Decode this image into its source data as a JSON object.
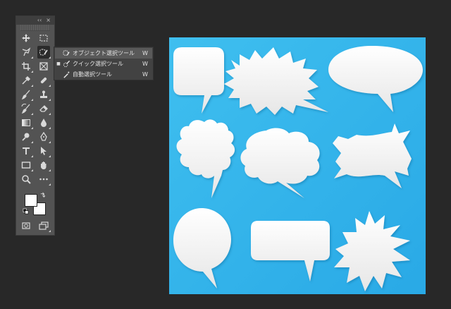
{
  "toolbar": {
    "collapse_label": "‹‹",
    "close_label": "×",
    "tools": [
      {
        "name": "move-tool-icon"
      },
      {
        "name": "marquee-tool-icon"
      },
      {
        "name": "lasso-tool-icon"
      },
      {
        "name": "object-selection-tool-icon",
        "active": true
      },
      {
        "name": "crop-tool-icon"
      },
      {
        "name": "frame-tool-icon"
      },
      {
        "name": "eyedropper-tool-icon"
      },
      {
        "name": "healing-brush-tool-icon"
      },
      {
        "name": "brush-tool-icon"
      },
      {
        "name": "clone-stamp-tool-icon"
      },
      {
        "name": "history-brush-tool-icon"
      },
      {
        "name": "eraser-tool-icon"
      },
      {
        "name": "gradient-tool-icon"
      },
      {
        "name": "blur-tool-icon"
      },
      {
        "name": "dodge-tool-icon"
      },
      {
        "name": "pen-tool-icon"
      },
      {
        "name": "type-tool-icon"
      },
      {
        "name": "path-selection-tool-icon"
      },
      {
        "name": "rectangle-tool-icon"
      },
      {
        "name": "hand-tool-icon"
      },
      {
        "name": "zoom-tool-icon"
      },
      {
        "name": "more-tools-icon"
      }
    ],
    "foreground_color": "#ffffff",
    "background_color": "#ffffff"
  },
  "flyout": {
    "items": [
      {
        "label": "オブジェクト選択ツール",
        "shortcut": "W",
        "selected": true,
        "icon": "object-selection-icon"
      },
      {
        "label": "クイック選択ツール",
        "shortcut": "W",
        "selected": false,
        "icon": "quick-selection-icon"
      },
      {
        "label": "自動選択ツール",
        "shortcut": "W",
        "selected": false,
        "icon": "magic-wand-icon"
      }
    ]
  },
  "canvas": {
    "background_color": "#33b5ec",
    "bubble_color": "#f4f4f4"
  }
}
